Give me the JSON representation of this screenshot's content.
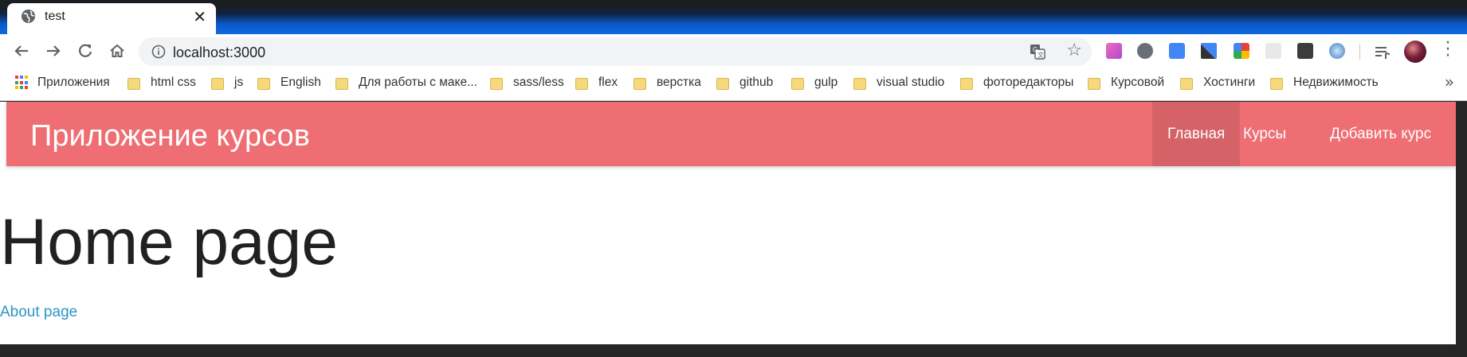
{
  "tab": {
    "title": "test"
  },
  "toolbar": {
    "url": "localhost:3000"
  },
  "bookmarks": {
    "apps_label": "Приложения",
    "items": [
      "html css",
      "js",
      "English",
      "Для работы с маке...",
      "sass/less",
      "flex",
      "верстка",
      "github",
      "gulp",
      "visual studio",
      "фоторедакторы",
      "Курсовой",
      "Хостинги",
      "Недвижимость"
    ],
    "more": "»"
  },
  "page": {
    "brand": "Приложение курсов",
    "nav": {
      "home": "Главная",
      "courses": "Курсы",
      "add": "Добавить курс"
    },
    "heading": "Home page",
    "link": "About page"
  },
  "colors": {
    "navbar": "#ee6e73",
    "link": "#2e94c5",
    "chrome_frame": "#0d6be0"
  },
  "icons": {
    "back": "arrow-left-icon",
    "forward": "arrow-right-icon",
    "reload": "reload-icon",
    "home": "home-icon",
    "info": "info-icon",
    "translate": "translate-icon",
    "star": "star-icon",
    "menu": "kebab-menu-icon"
  }
}
